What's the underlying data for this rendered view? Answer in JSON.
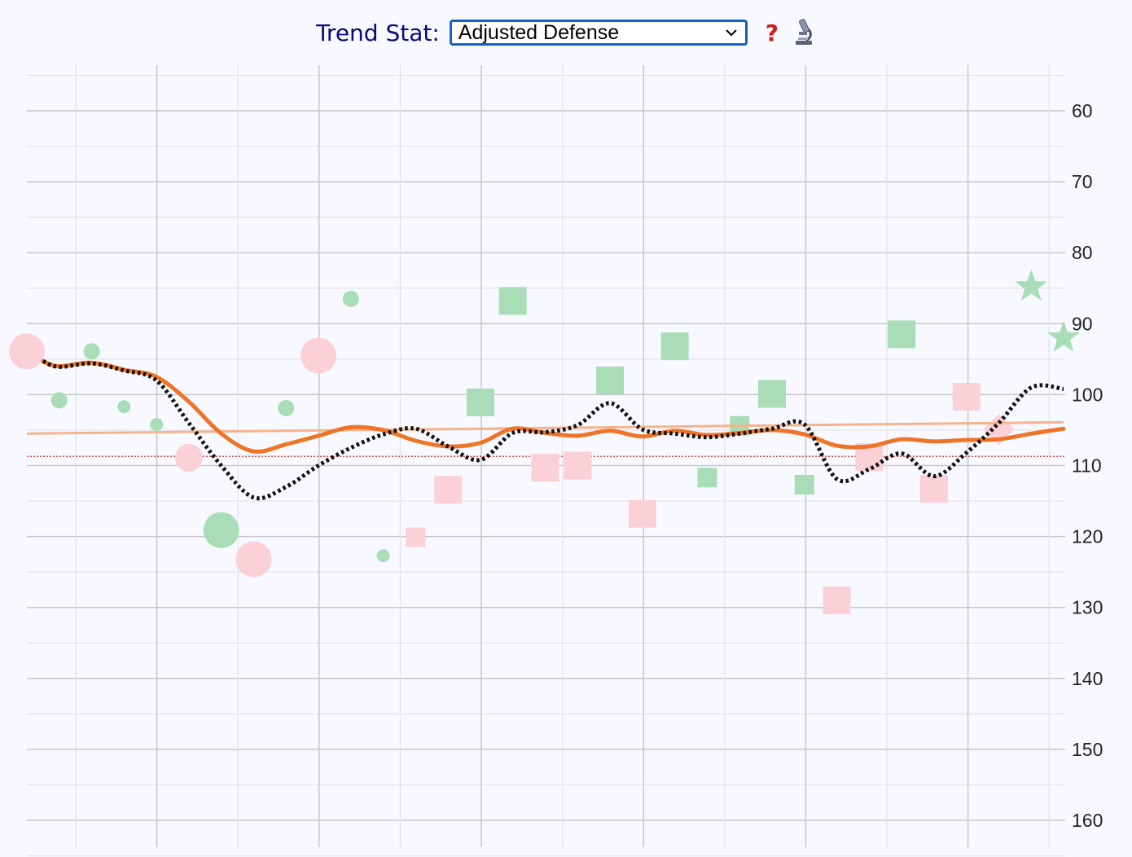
{
  "header": {
    "label": "Trend Stat:",
    "selected_option": "Adjusted Defense"
  },
  "icons": {
    "help": "question-mark-icon",
    "microscope": "microscope-icon"
  },
  "colors": {
    "background": "#f8f9ff",
    "good_marker": "#a8ddb8",
    "bad_marker": "#fbd0d6",
    "smooth_line": "#ee7527",
    "trend_line": "#f4b48c",
    "dotted_line": "#111111",
    "reference_line": "#cc1111"
  },
  "chart_data": {
    "type": "scatter",
    "y_axis": {
      "inverted": true,
      "range": [
        55,
        164
      ],
      "ticks": [
        60,
        70,
        80,
        90,
        100,
        110,
        120,
        130,
        140,
        150,
        160
      ],
      "position": "right"
    },
    "x_axis": {
      "range": [
        0,
        32
      ],
      "tick_labels": []
    },
    "grid": true,
    "reference_value": 108.7,
    "points": [
      {
        "x": 0,
        "y": 93.9,
        "shape": "circle",
        "result": "loss",
        "size": "large"
      },
      {
        "x": 1,
        "y": 100.8,
        "shape": "circle",
        "result": "win",
        "size": "small"
      },
      {
        "x": 2,
        "y": 93.9,
        "shape": "circle",
        "result": "win",
        "size": "small"
      },
      {
        "x": 3,
        "y": 101.7,
        "shape": "circle",
        "result": "win",
        "size": "tiny"
      },
      {
        "x": 4,
        "y": 104.2,
        "shape": "circle",
        "result": "win",
        "size": "tiny"
      },
      {
        "x": 5,
        "y": 108.9,
        "shape": "circle",
        "result": "loss",
        "size": "medium"
      },
      {
        "x": 6,
        "y": 119.1,
        "shape": "circle",
        "result": "win",
        "size": "large"
      },
      {
        "x": 7,
        "y": 123.2,
        "shape": "circle",
        "result": "loss",
        "size": "large"
      },
      {
        "x": 8,
        "y": 101.9,
        "shape": "circle",
        "result": "win",
        "size": "small"
      },
      {
        "x": 9,
        "y": 94.5,
        "shape": "circle",
        "result": "loss",
        "size": "large"
      },
      {
        "x": 10,
        "y": 86.5,
        "shape": "circle",
        "result": "win",
        "size": "small"
      },
      {
        "x": 11,
        "y": 122.7,
        "shape": "circle",
        "result": "win",
        "size": "tiny"
      },
      {
        "x": 12,
        "y": 120.1,
        "shape": "square",
        "result": "loss",
        "size": "small"
      },
      {
        "x": 13,
        "y": 113.4,
        "shape": "square",
        "result": "loss",
        "size": "medium"
      },
      {
        "x": 14,
        "y": 101.1,
        "shape": "square",
        "result": "win",
        "size": "medium"
      },
      {
        "x": 15,
        "y": 86.8,
        "shape": "square",
        "result": "win",
        "size": "medium"
      },
      {
        "x": 16,
        "y": 110.3,
        "shape": "square",
        "result": "loss",
        "size": "medium"
      },
      {
        "x": 17,
        "y": 110.0,
        "shape": "square",
        "result": "loss",
        "size": "medium"
      },
      {
        "x": 18,
        "y": 98.0,
        "shape": "square",
        "result": "win",
        "size": "medium"
      },
      {
        "x": 19,
        "y": 116.8,
        "shape": "square",
        "result": "loss",
        "size": "medium"
      },
      {
        "x": 20,
        "y": 93.2,
        "shape": "square",
        "result": "win",
        "size": "medium"
      },
      {
        "x": 21,
        "y": 111.7,
        "shape": "square",
        "result": "win",
        "size": "small"
      },
      {
        "x": 22,
        "y": 104.4,
        "shape": "square",
        "result": "win",
        "size": "small"
      },
      {
        "x": 23,
        "y": 99.9,
        "shape": "square",
        "result": "win",
        "size": "medium"
      },
      {
        "x": 24,
        "y": 112.7,
        "shape": "square",
        "result": "win",
        "size": "small"
      },
      {
        "x": 25,
        "y": 129.0,
        "shape": "square",
        "result": "loss",
        "size": "medium"
      },
      {
        "x": 26,
        "y": 108.8,
        "shape": "square",
        "result": "loss",
        "size": "medium"
      },
      {
        "x": 27,
        "y": 91.5,
        "shape": "square",
        "result": "win",
        "size": "medium"
      },
      {
        "x": 28,
        "y": 113.3,
        "shape": "square",
        "result": "loss",
        "size": "medium"
      },
      {
        "x": 29,
        "y": 100.3,
        "shape": "square",
        "result": "loss",
        "size": "medium"
      },
      {
        "x": 30,
        "y": 104.9,
        "shape": "diamond",
        "result": "loss",
        "size": "medium"
      },
      {
        "x": 31,
        "y": 84.8,
        "shape": "star",
        "result": "win",
        "size": "medium"
      },
      {
        "x": 32,
        "y": 92.0,
        "shape": "star",
        "result": "win",
        "size": "medium"
      }
    ],
    "smoothed_series": {
      "x": [
        0.5,
        1,
        2,
        3,
        4,
        5,
        6,
        7,
        8,
        9,
        10,
        11,
        12,
        13,
        14,
        15,
        16,
        17,
        18,
        19,
        20,
        21,
        22,
        23,
        24,
        25,
        26,
        27,
        28,
        29,
        30,
        31,
        32
      ],
      "y": [
        95.3,
        96.0,
        95.5,
        96.5,
        97.5,
        101.0,
        105.5,
        108.0,
        107.0,
        105.8,
        104.6,
        105.0,
        106.5,
        107.3,
        106.8,
        104.8,
        105.4,
        105.8,
        105.1,
        105.9,
        105.1,
        105.7,
        105.4,
        105.0,
        105.6,
        107.2,
        107.3,
        106.3,
        106.6,
        106.4,
        106.3,
        105.5,
        104.8
      ]
    },
    "dotted_series": {
      "x": [
        0.5,
        1,
        2,
        3,
        4,
        5,
        6,
        7,
        8,
        9,
        10,
        11,
        12,
        13,
        14,
        15,
        16,
        17,
        18,
        19,
        20,
        21,
        22,
        23,
        24,
        25,
        26,
        27,
        28,
        29,
        30,
        31,
        32
      ],
      "y": [
        95.3,
        96.1,
        95.6,
        96.6,
        98.0,
        104.0,
        110.0,
        114.5,
        113.0,
        110.0,
        107.5,
        105.6,
        104.8,
        107.3,
        109.2,
        105.4,
        105.3,
        104.3,
        101.2,
        104.9,
        105.5,
        106.0,
        105.5,
        104.8,
        104.2,
        111.9,
        110.5,
        108.3,
        111.5,
        108.2,
        104.0,
        99.0,
        99.2
      ]
    },
    "trend_line": {
      "x": [
        0,
        32
      ],
      "y": [
        105.5,
        103.9
      ]
    }
  }
}
